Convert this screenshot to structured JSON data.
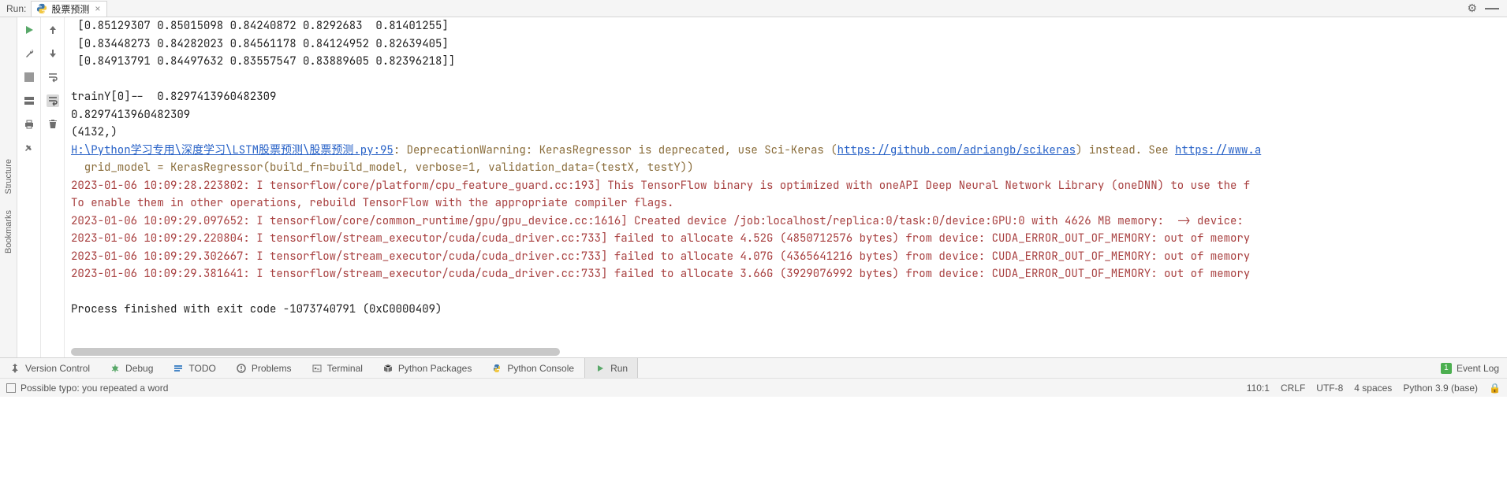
{
  "topbar": {
    "label": "Run:",
    "tab_name": "股票预测"
  },
  "left_rail": {
    "structure": "Structure",
    "bookmarks": "Bookmarks"
  },
  "console": {
    "line1": " [0.85129307 0.85015098 0.84240872 0.8292683  0.81401255]",
    "line2": " [0.83448273 0.84282023 0.84561178 0.84124952 0.82639405]",
    "line3": " [0.84913791 0.84497632 0.83557547 0.83889605 0.82396218]]",
    "line4": "",
    "line5": "trainY[0]--  0.8297413960482309",
    "line6": "0.8297413960482309",
    "line7": "(4132,)",
    "link1": "H:\\Python学习专用\\深度学习\\LSTM股票预测\\股票预测.py:95",
    "warn1_a": ": DeprecationWarning: KerasRegressor is deprecated, use Sci-Keras (",
    "link2": "https://github.com/adriangb/scikeras",
    "warn1_b": ") instead. See ",
    "link3": "https://www.a",
    "warn2": "  grid_model = KerasRegressor(build_fn=build_model, verbose=1, validation_data=(testX, testY))",
    "err1": "2023-01-06 10:09:28.223802: I tensorflow/core/platform/cpu_feature_guard.cc:193] This TensorFlow binary is optimized with oneAPI Deep Neural Network Library (oneDNN) to use the f",
    "err2": "To enable them in other operations, rebuild TensorFlow with the appropriate compiler flags.",
    "err3": "2023-01-06 10:09:29.097652: I tensorflow/core/common_runtime/gpu/gpu_device.cc:1616] Created device /job:localhost/replica:0/task:0/device:GPU:0 with 4626 MB memory:  -> device: ",
    "err4": "2023-01-06 10:09:29.220804: I tensorflow/stream_executor/cuda/cuda_driver.cc:733] failed to allocate 4.52G (4850712576 bytes) from device: CUDA_ERROR_OUT_OF_MEMORY: out of memory",
    "err5": "2023-01-06 10:09:29.302667: I tensorflow/stream_executor/cuda/cuda_driver.cc:733] failed to allocate 4.07G (4365641216 bytes) from device: CUDA_ERROR_OUT_OF_MEMORY: out of memory",
    "err6": "2023-01-06 10:09:29.381641: I tensorflow/stream_executor/cuda/cuda_driver.cc:733] failed to allocate 3.66G (3929076992 bytes) from device: CUDA_ERROR_OUT_OF_MEMORY: out of memory",
    "line_blank": "",
    "exit": "Process finished with exit code -1073740791 (0xC0000409)"
  },
  "bottom_tabs": {
    "version_control": "Version Control",
    "debug": "Debug",
    "todo": "TODO",
    "problems": "Problems",
    "terminal": "Terminal",
    "python_packages": "Python Packages",
    "python_console": "Python Console",
    "run": "Run",
    "event_log": "Event Log",
    "badge": "1"
  },
  "statusbar": {
    "message": "Possible typo: you repeated a word",
    "pos": "110:1",
    "line_sep": "CRLF",
    "encoding": "UTF-8",
    "indent": "4 spaces",
    "interpreter": "Python 3.9 (base)"
  }
}
